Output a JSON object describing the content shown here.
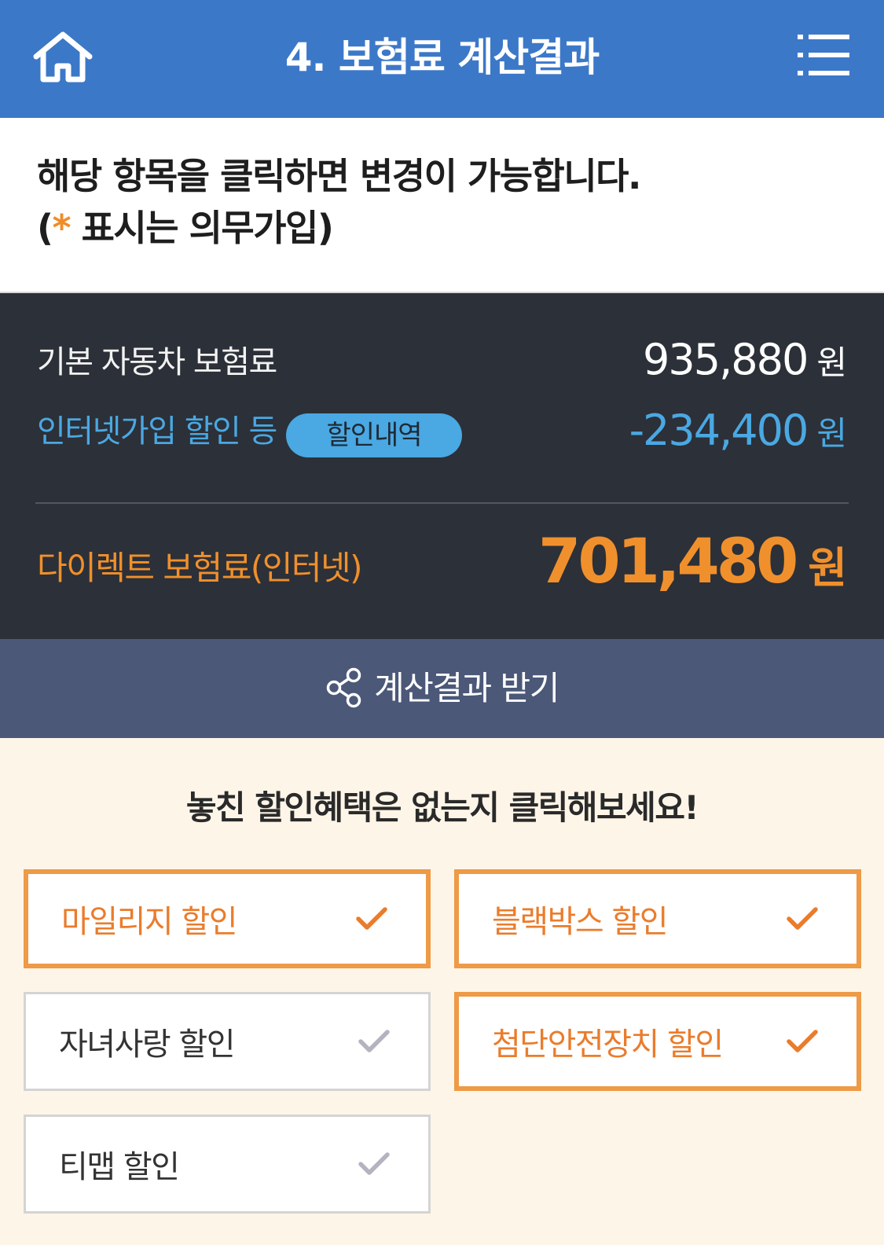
{
  "header": {
    "title": "4. 보험료 계산결과",
    "home_icon": "home-icon",
    "menu_icon": "menu-list-icon"
  },
  "notice": {
    "line1": "해당 항목을 클릭하면 변경이 가능합니다.",
    "line2_open": "(",
    "star": "*",
    "line2_text": "표시는 의무가입)"
  },
  "summary": {
    "basic": {
      "label": "기본 자동차 보험료",
      "amount": "935,880",
      "unit": "원"
    },
    "discount": {
      "label": "인터넷가입 할인 등",
      "badge": "할인내역",
      "amount": "-234,400",
      "unit": "원"
    },
    "direct": {
      "label": "다이렉트 보험료(인터넷)",
      "amount": "701,480",
      "unit": "원"
    }
  },
  "share": {
    "label": "계산결과 받기",
    "icon": "share-icon"
  },
  "discounts": {
    "heading": "놓친 할인혜택은 없는지 클릭해보세요!",
    "options": [
      {
        "label": "마일리지 할인",
        "selected": true
      },
      {
        "label": "블랙박스 할인",
        "selected": true
      },
      {
        "label": "자녀사랑 할인",
        "selected": false
      },
      {
        "label": "첨단안전장치 할인",
        "selected": true
      },
      {
        "label": "티맵 할인",
        "selected": false
      }
    ]
  },
  "colors": {
    "header": "#3c78c8",
    "summary_bg": "#2c3038",
    "accent_blue": "#4aa8e2",
    "accent_orange": "#f0902c",
    "share_bar": "#4b5878",
    "page_bg": "#fdf5e8",
    "check_selected": "#ea7c2c",
    "check_unselected": "#b4b4c0"
  }
}
